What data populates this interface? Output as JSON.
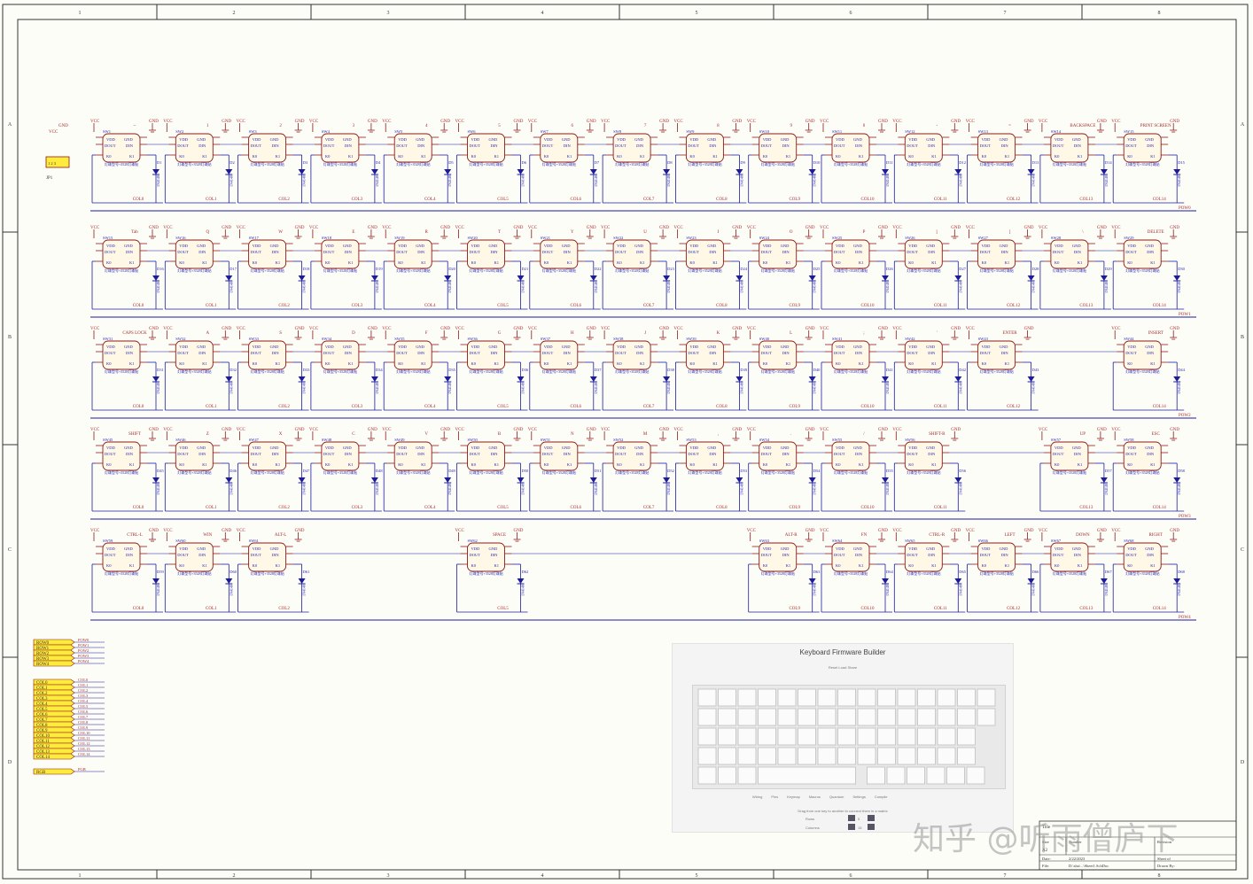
{
  "border": {
    "columns": [
      "1",
      "2",
      "3",
      "4",
      "5",
      "6",
      "7",
      "8"
    ],
    "rows": [
      "A",
      "B",
      "C",
      "D"
    ]
  },
  "matrix": {
    "rows": [
      {
        "net": "POW0",
        "sw_start": 1,
        "d_start": 1,
        "cols": [
          0,
          1,
          2,
          3,
          4,
          5,
          6,
          7,
          8,
          9,
          10,
          11,
          12,
          13,
          14
        ],
        "keys": [
          "~",
          "1",
          "2",
          "3",
          "4",
          "5",
          "6",
          "7",
          "8",
          "9",
          "0",
          "-",
          "=",
          "BACKSPACE",
          "PRINT SCREEN"
        ]
      },
      {
        "net": "POW1",
        "sw_start": 15,
        "d_start": 16,
        "cols": [
          0,
          1,
          2,
          3,
          4,
          5,
          6,
          7,
          8,
          9,
          10,
          11,
          12,
          13,
          14
        ],
        "keys": [
          "Tab",
          "Q",
          "W",
          "E",
          "R",
          "T",
          "Y",
          "U",
          "I",
          "O",
          "P",
          "[",
          "]",
          "\\",
          "DELETE"
        ]
      },
      {
        "net": "POW2",
        "sw_start": 31,
        "d_start": 31,
        "cols": [
          0,
          1,
          2,
          3,
          4,
          5,
          6,
          7,
          8,
          9,
          10,
          11,
          12,
          14
        ],
        "keys": [
          "CAPS LOCK",
          "A",
          "S",
          "D",
          "F",
          "G",
          "H",
          "J",
          "K",
          "L",
          ";",
          "'",
          "ENTER",
          "INSERT"
        ]
      },
      {
        "net": "POW3",
        "sw_start": 45,
        "d_start": 45,
        "cols": [
          0,
          1,
          2,
          3,
          4,
          5,
          6,
          7,
          8,
          9,
          10,
          11,
          13,
          14
        ],
        "keys": [
          "SHIFT",
          "Z",
          "X",
          "C",
          "V",
          "B",
          "N",
          "M",
          ",",
          ".",
          "/",
          "SHIFT-R",
          "UP",
          "ESC"
        ]
      },
      {
        "net": "POW4",
        "sw_start": 59,
        "d_start": 59,
        "cols": [
          0,
          1,
          2,
          5,
          9,
          10,
          11,
          12,
          13,
          14
        ],
        "keys": [
          "CTRL-L",
          "WIN",
          "ALT-L",
          "SPACE",
          "ALT-R",
          "FN",
          "CTRL-R",
          "LEFT",
          "DOWN",
          "RIGHT"
        ]
      }
    ],
    "part_label": "WS2812B",
    "part_label_full": "灯珠型号+3528灯珠贴",
    "diode_part": "1N4148",
    "pins": {
      "vdd": "VDD",
      "gnd": "GND",
      "dout": "DOUT",
      "din": "DIN",
      "k0": "K0",
      "k1": "K1"
    },
    "power_vcc": "VCC",
    "power_gnd": "GND",
    "rgb_net": "PGB"
  },
  "connector": {
    "ref": "JP1",
    "vcc": "VCC",
    "gnd": "GND"
  },
  "ports": {
    "rows": [
      "ROW0",
      "ROW1",
      "ROW2",
      "ROW3",
      "ROW4"
    ],
    "row_nets": [
      "POW0",
      "POW1",
      "POW2",
      "POW3",
      "POW4"
    ],
    "cols": [
      "COL0",
      "COL1",
      "COL2",
      "COL3",
      "COL4",
      "COL5",
      "COL6",
      "COL7",
      "COL8",
      "COL9",
      "COL10",
      "COL11",
      "COL12",
      "COL13",
      "COL14"
    ],
    "rgb": "RGB",
    "rgb_net": "PGB"
  },
  "inset": {
    "title": "Keyboard Firmware Builder",
    "subtitle": "Reset  Load  Share",
    "tabs": [
      "Wiring",
      "Pins",
      "Keymap",
      "Macros",
      "Quantum",
      "Settings",
      "Compile"
    ],
    "note": "Drag from one key to another to connect them in a matrix",
    "rows_label": "Rows",
    "cols_label": "Columns",
    "rows_value": "5",
    "cols_value": "15"
  },
  "title_block": {
    "title": "Title",
    "size_label": "Size",
    "size": "A2",
    "number_label": "Number",
    "revision_label": "Revision",
    "date_label": "Date:",
    "date": "2/22/2023",
    "file_label": "File:",
    "file": "D:\\sha\\...\\Sheet1.SchDoc",
    "sheet_label": "Sheet   of",
    "drawn_label": "Drawn By:"
  },
  "watermark": "知乎 @听雨僧庐下",
  "colors": {
    "wire": "#1c1c9c",
    "part": "#8b1a1a",
    "part_fill": "#fff8e6",
    "power": "#a52a2a",
    "port": "#ffeb3b",
    "text_blue": "#1c1cb0",
    "grid": "#888"
  }
}
